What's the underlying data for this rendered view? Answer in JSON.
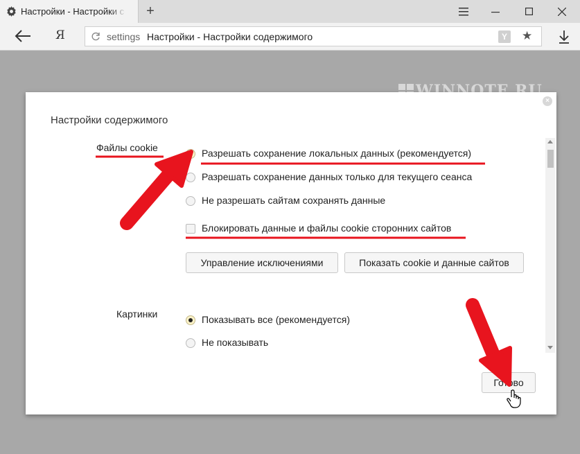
{
  "tab": {
    "title": "Настройки - Настройки содержимого"
  },
  "address": {
    "prefix": "settings",
    "title": "Настройки - Настройки содержимого",
    "badge": "Y"
  },
  "navbar": {
    "yandex": "Я"
  },
  "watermark": "WINNOTE.RU",
  "dialog": {
    "title": "Настройки содержимого",
    "cookies": {
      "label": "Файлы cookie",
      "options": [
        {
          "label": "Разрешать сохранение локальных данных (рекомендуется)",
          "checked": true
        },
        {
          "label": "Разрешать сохранение данных только для текущего сеанса",
          "checked": false
        },
        {
          "label": "Не разрешать сайтам сохранять данные",
          "checked": false
        }
      ],
      "block_third_party": {
        "label": "Блокировать данные и файлы cookie сторонних сайтов",
        "checked": false
      },
      "manage_exceptions_button": "Управление исключениями",
      "show_cookies_button": "Показать cookie и данные сайтов"
    },
    "images": {
      "label": "Картинки",
      "options": [
        {
          "label": "Показывать все (рекомендуется)",
          "checked": true
        },
        {
          "label": "Не показывать",
          "checked": false
        }
      ]
    },
    "done_button": "Готово"
  },
  "annotation_color": "#e8141e"
}
